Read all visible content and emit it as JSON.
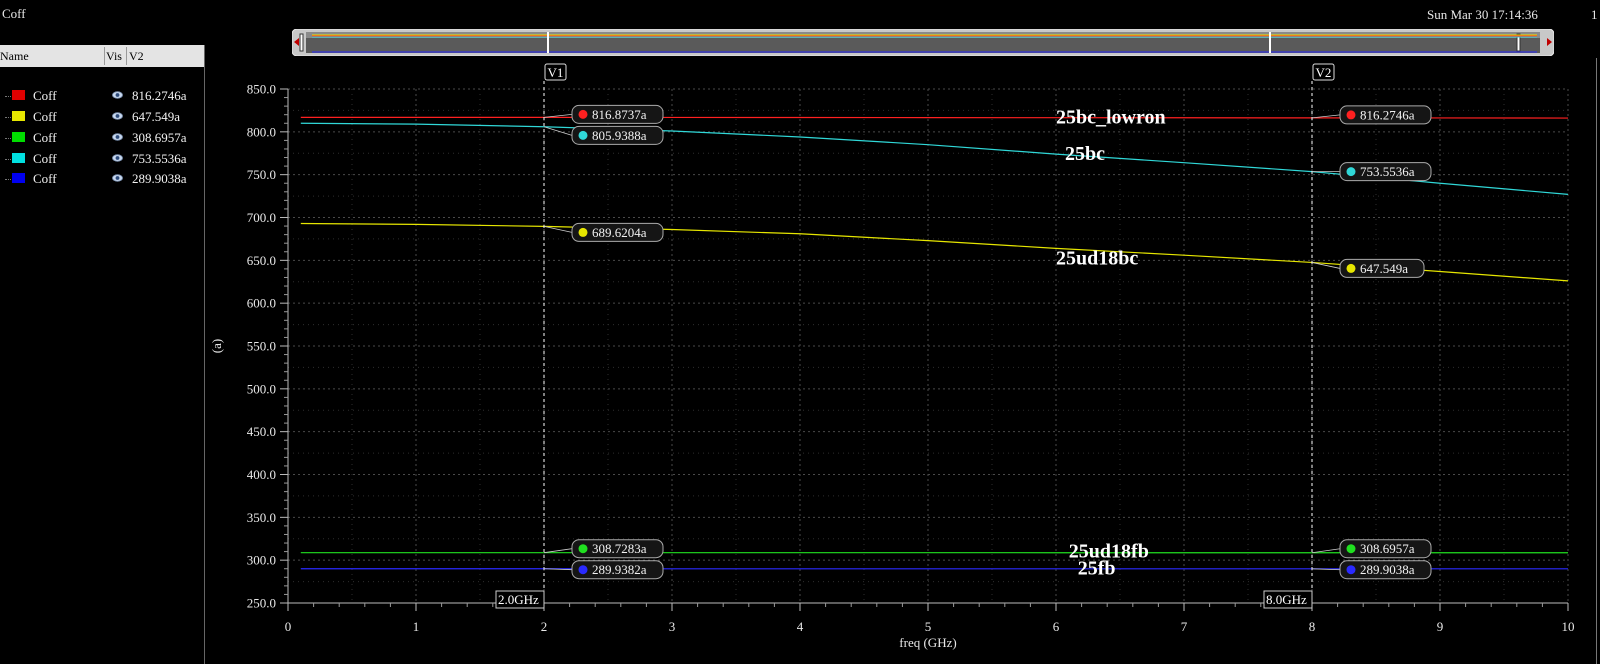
{
  "window": {
    "title": "Coff",
    "datetime": "Sun Mar 30 17:14:36",
    "edge_label": "1"
  },
  "panel": {
    "headers": {
      "name": "Name",
      "vis": "Vis",
      "v2": "V2"
    },
    "rows": [
      {
        "name": "Coff",
        "value": "816.2746a",
        "color": "#e00000",
        "icon": "eye-icon"
      },
      {
        "name": "Coff",
        "value": "647.549a",
        "color": "#e6e600",
        "icon": "eye-icon"
      },
      {
        "name": "Coff",
        "value": "308.6957a",
        "color": "#00dd00",
        "icon": "eye-icon"
      },
      {
        "name": "Coff",
        "value": "753.5536a",
        "color": "#00e0e0",
        "icon": "eye-icon"
      },
      {
        "name": "Coff",
        "value": "289.9038a",
        "color": "#0000f0",
        "icon": "eye-icon"
      }
    ]
  },
  "chart_data": {
    "type": "line",
    "xlabel": "freq (GHz)",
    "ylabel": "(a)",
    "xlim": [
      0,
      10
    ],
    "ylim": [
      250,
      850
    ],
    "x_ticks": [
      0,
      1,
      2,
      3,
      4,
      5,
      6,
      7,
      8,
      9,
      10
    ],
    "y_ticks": [
      250,
      300,
      350,
      400,
      450,
      500,
      550,
      600,
      650,
      700,
      750,
      800,
      850
    ],
    "y_tick_labels": [
      "250.0",
      "300.0",
      "350.0",
      "400.0",
      "450.0",
      "500.0",
      "550.0",
      "600.0",
      "650.0",
      "700.0",
      "750.0",
      "800.0",
      "850.0"
    ],
    "grid": true,
    "x": [
      0.1,
      1,
      2,
      3,
      4,
      5,
      6,
      7,
      8,
      9,
      10
    ],
    "series": [
      {
        "color": "#ff2020",
        "values": [
          816.9,
          816.9,
          816.87,
          816.8,
          816.7,
          816.6,
          816.5,
          816.4,
          816.27,
          816.2,
          816.1
        ]
      },
      {
        "color": "#30d8d8",
        "values": [
          810,
          809,
          805.94,
          801,
          794,
          785,
          774,
          764,
          753.55,
          740,
          727
        ]
      },
      {
        "color": "#e6e600",
        "values": [
          693,
          692,
          689.62,
          686,
          681,
          673,
          664,
          656,
          647.55,
          637,
          626
        ]
      },
      {
        "color": "#20e020",
        "values": [
          308.73,
          308.73,
          308.73,
          308.72,
          308.71,
          308.71,
          308.7,
          308.7,
          308.7,
          308.69,
          308.69
        ]
      },
      {
        "color": "#2a2aff",
        "values": [
          289.94,
          289.94,
          289.94,
          289.93,
          289.93,
          289.92,
          289.92,
          289.91,
          289.9,
          289.9,
          289.9
        ]
      }
    ],
    "annotations": [
      {
        "text": "25bc_lowron",
        "x": 6.0,
        "y": 810
      },
      {
        "text": "25bc",
        "x": 6.07,
        "y": 767
      },
      {
        "text": "25ud18bc",
        "x": 6.0,
        "y": 645
      },
      {
        "text": "25ud18fb",
        "x": 6.1,
        "y": 303
      },
      {
        "text": "25fb",
        "x": 6.17,
        "y": 283
      }
    ],
    "cursors": [
      {
        "name": "V1",
        "x": 2.0,
        "x_label": "2.0GHz",
        "markers": [
          {
            "value": 816.8737,
            "label": "816.8737a",
            "color": "#ff2020"
          },
          {
            "value": 805.9388,
            "label": "805.9388a",
            "color": "#30d8d8"
          },
          {
            "value": 689.6204,
            "label": "689.6204a",
            "color": "#e6e600"
          },
          {
            "value": 308.7283,
            "label": "308.7283a",
            "color": "#20e020"
          },
          {
            "value": 289.9382,
            "label": "289.9382a",
            "color": "#2a2aff"
          }
        ]
      },
      {
        "name": "V2",
        "x": 8.0,
        "x_label": "8.0GHz",
        "markers": [
          {
            "value": 816.2746,
            "label": "816.2746a",
            "color": "#ff2020"
          },
          {
            "value": 753.5536,
            "label": "753.5536a",
            "color": "#30d8d8"
          },
          {
            "value": 647.549,
            "label": "647.549a",
            "color": "#e6e600"
          },
          {
            "value": 308.6957,
            "label": "308.6957a",
            "color": "#20e020"
          },
          {
            "value": 289.9038,
            "label": "289.9038a",
            "color": "#2a2aff"
          }
        ]
      }
    ]
  }
}
